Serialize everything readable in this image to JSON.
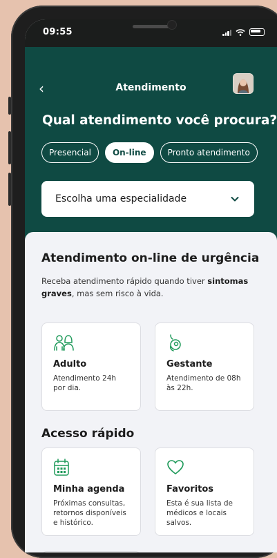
{
  "status_bar": {
    "time": "09:55"
  },
  "header": {
    "title": "Atendimento",
    "back_label": "‹",
    "question": "Qual atendimento você procura?",
    "tabs": [
      {
        "label": "Presencial",
        "active": false
      },
      {
        "label": "On-line",
        "active": true
      },
      {
        "label": "Pronto atendimento",
        "active": false
      }
    ],
    "specialty_select": {
      "value": "Escolha uma especialidade"
    }
  },
  "urgent": {
    "title": "Atendimento on-line de urgência",
    "desc_prefix": "Receba atendimento rápido quando tiver ",
    "desc_bold": "sintomas graves",
    "desc_suffix": ", mas sem risco à vida.",
    "cards": [
      {
        "title": "Adulto",
        "text": "Atendimento 24h por dia.",
        "icon": "adults-icon"
      },
      {
        "title": "Gestante",
        "text": "Atendimento de 08h às 22h.",
        "icon": "pregnant-icon"
      }
    ]
  },
  "quick_access": {
    "title": "Acesso rápido",
    "cards": [
      {
        "title": "Minha agenda",
        "text": "Próximas consultas, retornos disponíveis e histórico.",
        "icon": "calendar-icon"
      },
      {
        "title": "Favoritos",
        "text": "Esta é sua lista de médicos e locais salvos.",
        "icon": "heart-icon"
      }
    ]
  },
  "colors": {
    "brand": "#0f4a43",
    "accent_icon": "#1f9a5a",
    "background": "#f2f3f7"
  }
}
